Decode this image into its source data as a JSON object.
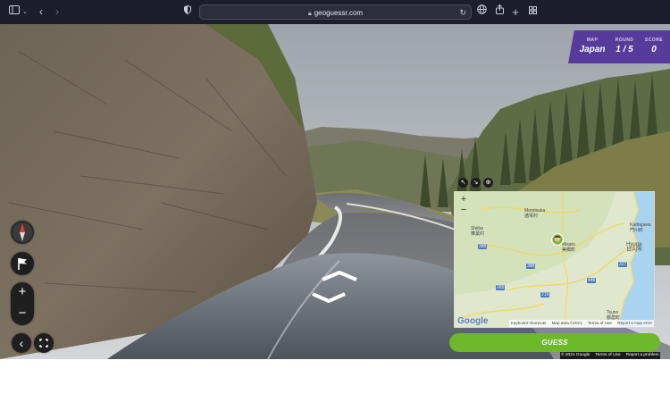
{
  "browser": {
    "url": "geoguessr.com"
  },
  "score_panel": {
    "map_label": "MAP",
    "map_value": "Japan",
    "round_label": "ROUND",
    "round_value": "1 / 5",
    "score_label": "SCORE",
    "score_value": "0"
  },
  "map": {
    "labels": {
      "morotsuka_roman": "Morotsuka",
      "morotsuka_kanji": "諸塚村",
      "shiiba_roman": "Shiiba",
      "shiiba_kanji": "椎葉村",
      "misato_roman": "Misato",
      "misato_kanji": "美郷町",
      "hyuga_roman": "Hyuga",
      "hyuga_kanji": "日向市",
      "kadogawa_roman": "Kadogawa",
      "kadogawa_kanji": "門川町",
      "tsuno_roman": "Tsuno",
      "tsuno_kanji": "都農町"
    },
    "route_badges": [
      "388",
      "327",
      "388",
      "446",
      "265",
      "219"
    ],
    "zoom_in": "+",
    "zoom_out": "−",
    "logo": "Google",
    "footer": {
      "shortcuts": "Keyboard shortcuts",
      "data": "Map data ©2021",
      "terms": "Terms of Use",
      "report": "Report a map error"
    }
  },
  "guess_button": "GUESS",
  "attribution": {
    "copyright": "© 2021 Google",
    "terms": "Terms of Use",
    "report": "Report a problem"
  },
  "controls": {
    "zoom_in": "+",
    "zoom_out": "−"
  },
  "colors": {
    "accent_green": "#6cb92b",
    "panel_purple": "#563b9b",
    "toolbar_bg": "#1d1e2b"
  }
}
